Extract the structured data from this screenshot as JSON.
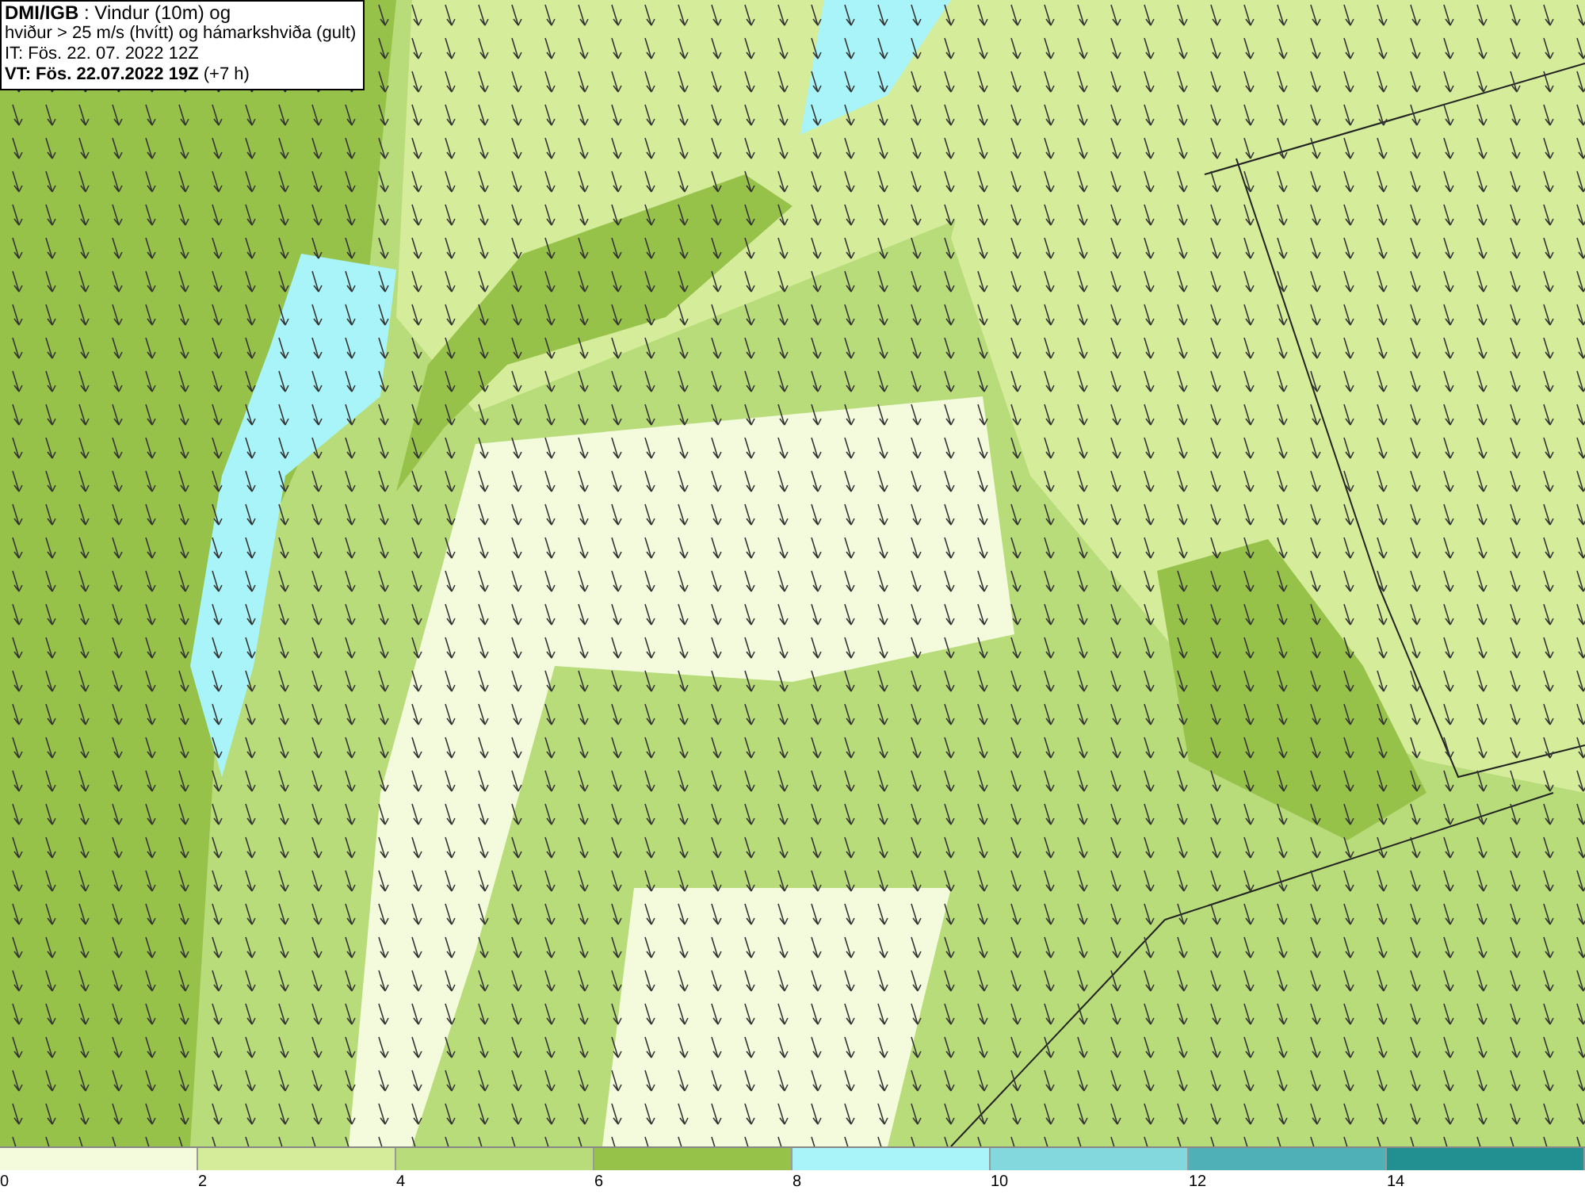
{
  "info_box": {
    "lines": [
      "**DMI/IGB** : Vindur (10m) og",
      "hviður > 25 m/s (hvítt) og hámarkshviða (gult)",
      "IT: Fös. 22. 07. 2022 12Z",
      "**VT: Fös. 22.07.2022 19Z** (+7 h)"
    ]
  },
  "legend": {
    "bins": [
      {
        "color": "#f4fbdc"
      },
      {
        "color": "#d5ec9b"
      },
      {
        "color": "#b8dc7a"
      },
      {
        "color": "#97c24a"
      },
      {
        "color": "#a8f4f8"
      },
      {
        "color": "#82d8dc"
      },
      {
        "color": "#4fb0b8"
      },
      {
        "color": "#228f90"
      }
    ],
    "ticks": [
      "0",
      "2",
      "4",
      "6",
      "8",
      "10",
      "12",
      "14"
    ]
  }
}
